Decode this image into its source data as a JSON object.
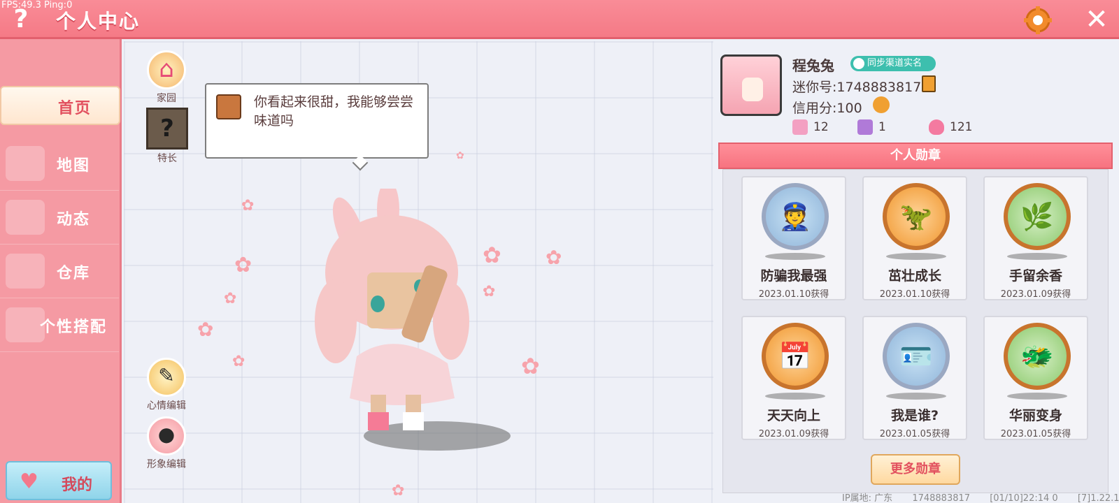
{
  "debug": {
    "fps_text": "FPS:49.3  Ping:0"
  },
  "header": {
    "title": "个人中心",
    "help_icon": "question-mark-icon",
    "settings_icon": "gear-icon",
    "close_icon": "close-icon",
    "accent": "#f57a86"
  },
  "sidebar": {
    "items": [
      {
        "label": "首页",
        "active": true
      },
      {
        "label": "地图"
      },
      {
        "label": "动态"
      },
      {
        "label": "仓库"
      },
      {
        "label": "个性搭配"
      }
    ],
    "me_button": "我的"
  },
  "center": {
    "home_label": "家园",
    "skill_label": "特长",
    "speech_text": "你看起来很甜，我能够尝尝味道吗",
    "mood_edit_label": "心情编辑",
    "look_edit_label": "形象编辑"
  },
  "profile": {
    "name": "程兔兔",
    "sync_badge": "同步渠道实名",
    "mini_id": "迷你号:1748883817",
    "credit": "信用分:100",
    "stats": [
      {
        "icon": "bookmark-plus-icon",
        "value": "12"
      },
      {
        "icon": "cheer-icon",
        "value": "1"
      },
      {
        "icon": "flame-icon",
        "value": "121"
      }
    ]
  },
  "medals": {
    "header": "个人勋章",
    "items": [
      {
        "name": "防骗我最强",
        "date": "2023.01.10获得",
        "style": "blue",
        "icon": "police-icon"
      },
      {
        "name": "茁壮成长",
        "date": "2023.01.10获得",
        "style": "gold",
        "icon": "dino-crown-icon"
      },
      {
        "name": "手留余香",
        "date": "2023.01.09获得",
        "style": "green",
        "icon": "dino-leaf-icon"
      },
      {
        "name": "天天向上",
        "date": "2023.01.09获得",
        "style": "gold",
        "icon": "calendar-check-icon"
      },
      {
        "name": "我是谁?",
        "date": "2023.01.05获得",
        "style": "blue",
        "icon": "id-card-icon"
      },
      {
        "name": "华丽变身",
        "date": "2023.01.05获得",
        "style": "green",
        "icon": "dino-costume-icon"
      }
    ],
    "more_button": "更多勋章"
  },
  "footer": {
    "ip": "IP属地: 广东",
    "uid": "1748883817",
    "time": "[01/10]22:14 0",
    "version": "[7]1.22.1"
  }
}
